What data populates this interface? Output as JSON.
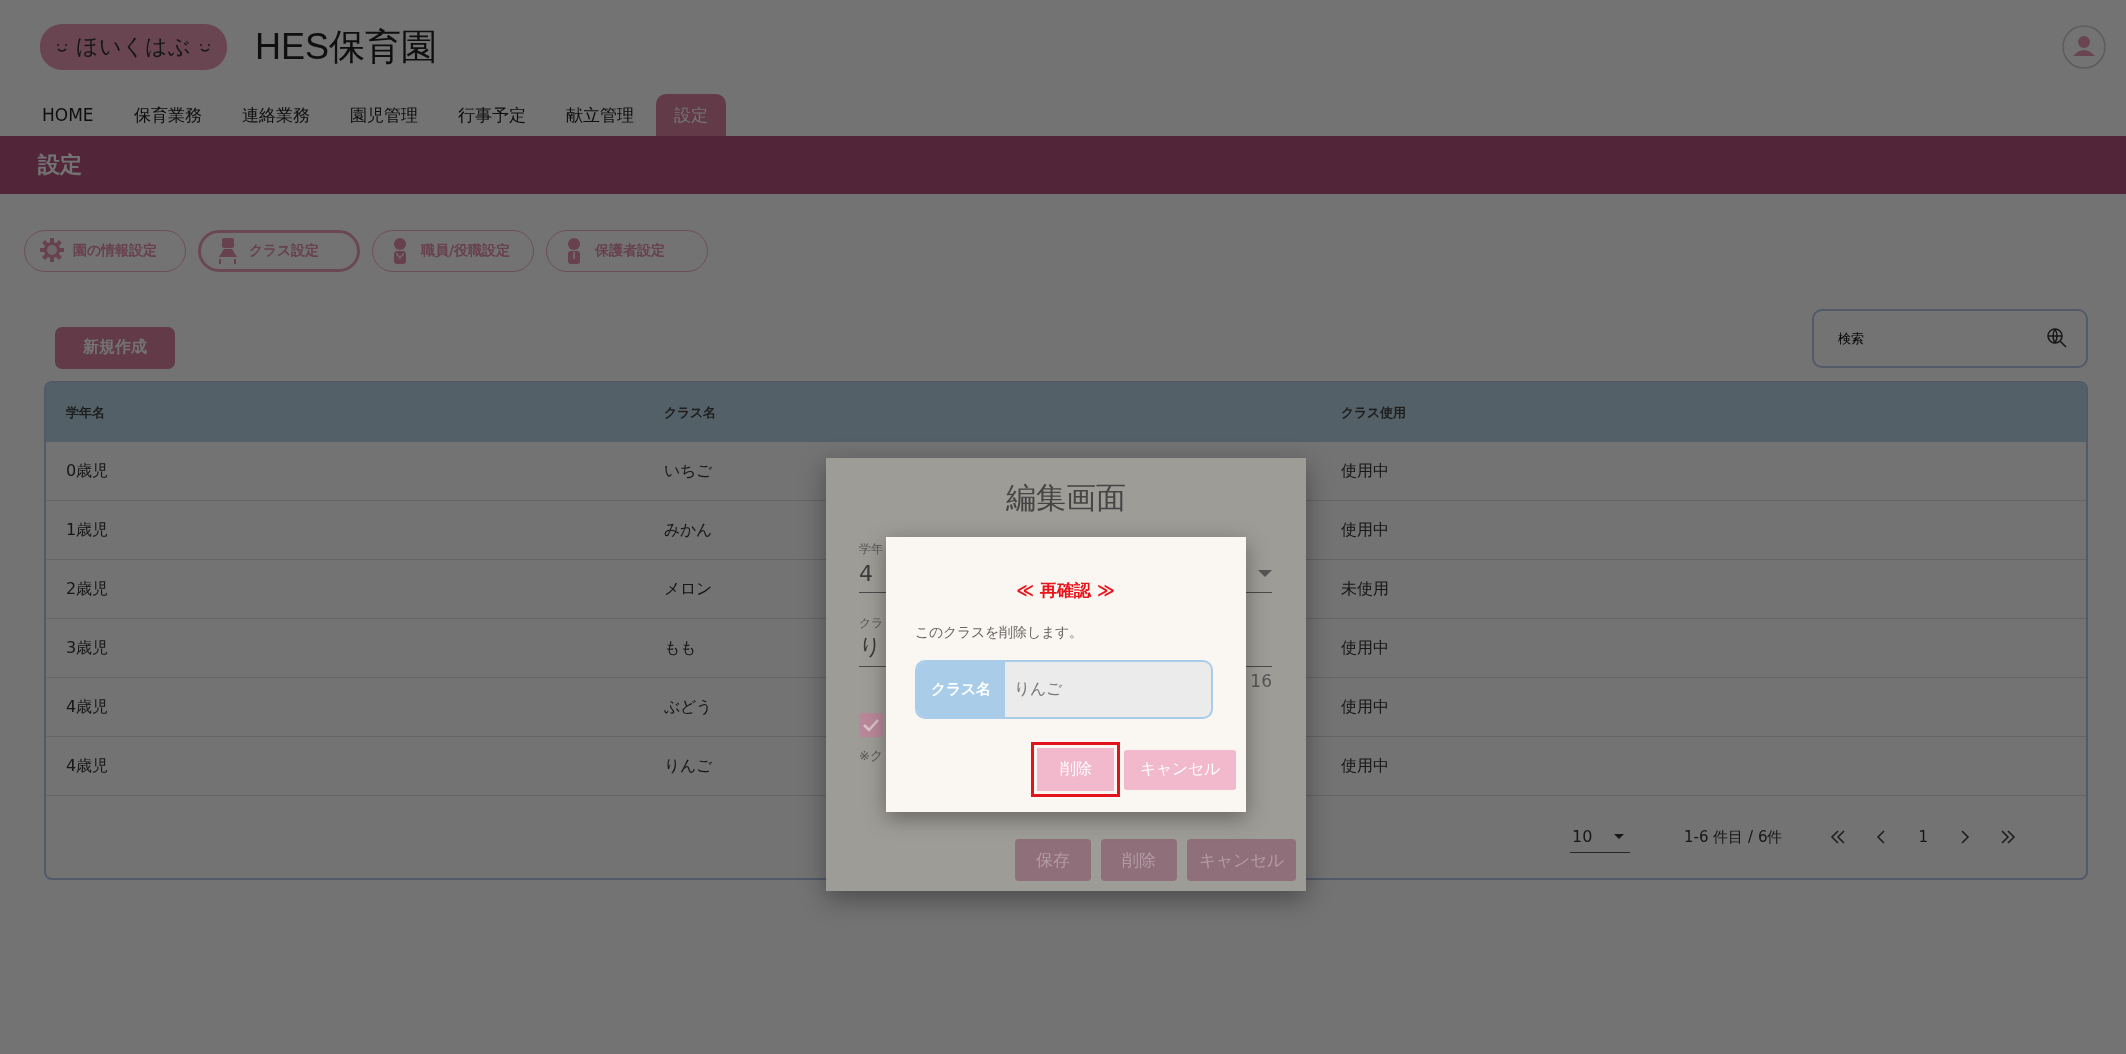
{
  "header": {
    "logo": "ほいくはぶ",
    "title": "HES保育園"
  },
  "nav": [
    {
      "label": "HOME",
      "selected": false
    },
    {
      "label": "保育業務",
      "selected": false
    },
    {
      "label": "連絡業務",
      "selected": false
    },
    {
      "label": "園児管理",
      "selected": false
    },
    {
      "label": "行事予定",
      "selected": false
    },
    {
      "label": "献立管理",
      "selected": false
    },
    {
      "label": "設定",
      "selected": true
    }
  ],
  "page_title": "設定",
  "settings_buttons": [
    {
      "label": "園の情報設定",
      "kind": "gear",
      "selected": false
    },
    {
      "label": "クラス設定",
      "kind": "desk",
      "selected": true
    },
    {
      "label": "職員/役職設定",
      "kind": "staff",
      "selected": false
    },
    {
      "label": "保護者設定",
      "kind": "parent",
      "selected": false
    }
  ],
  "new_button": "新規作成",
  "search": {
    "placeholder": "検索"
  },
  "table": {
    "columns": [
      "学年名",
      "クラス名",
      "クラス使用"
    ],
    "rows": [
      [
        "0歳児",
        "いちご",
        "使用中"
      ],
      [
        "1歳児",
        "みかん",
        "使用中"
      ],
      [
        "2歳児",
        "メロン",
        "未使用"
      ],
      [
        "3歳児",
        "もも",
        "使用中"
      ],
      [
        "4歳児",
        "ぶどう",
        "使用中"
      ],
      [
        "4歳児",
        "りんご",
        "使用中"
      ]
    ]
  },
  "pagination": {
    "page_size": "10",
    "range": "1-6 件目 / 6件",
    "page": "1"
  },
  "edit_dialog": {
    "title": "編集画面",
    "grade_label": "学年",
    "grade_value": "4",
    "class_label": "クラ",
    "class_value": "り",
    "counter": "16",
    "checked": true,
    "note": "※ク",
    "buttons": [
      "保存",
      "削除",
      "キャンセル"
    ]
  },
  "confirm_dialog": {
    "title": "≪ 再確認 ≫",
    "message": "このクラスを削除します。",
    "field_label": "クラス名",
    "field_value": "りんご",
    "buttons": [
      {
        "label": "削除",
        "focused": true
      },
      {
        "label": "キャンセル",
        "focused": false
      }
    ]
  }
}
